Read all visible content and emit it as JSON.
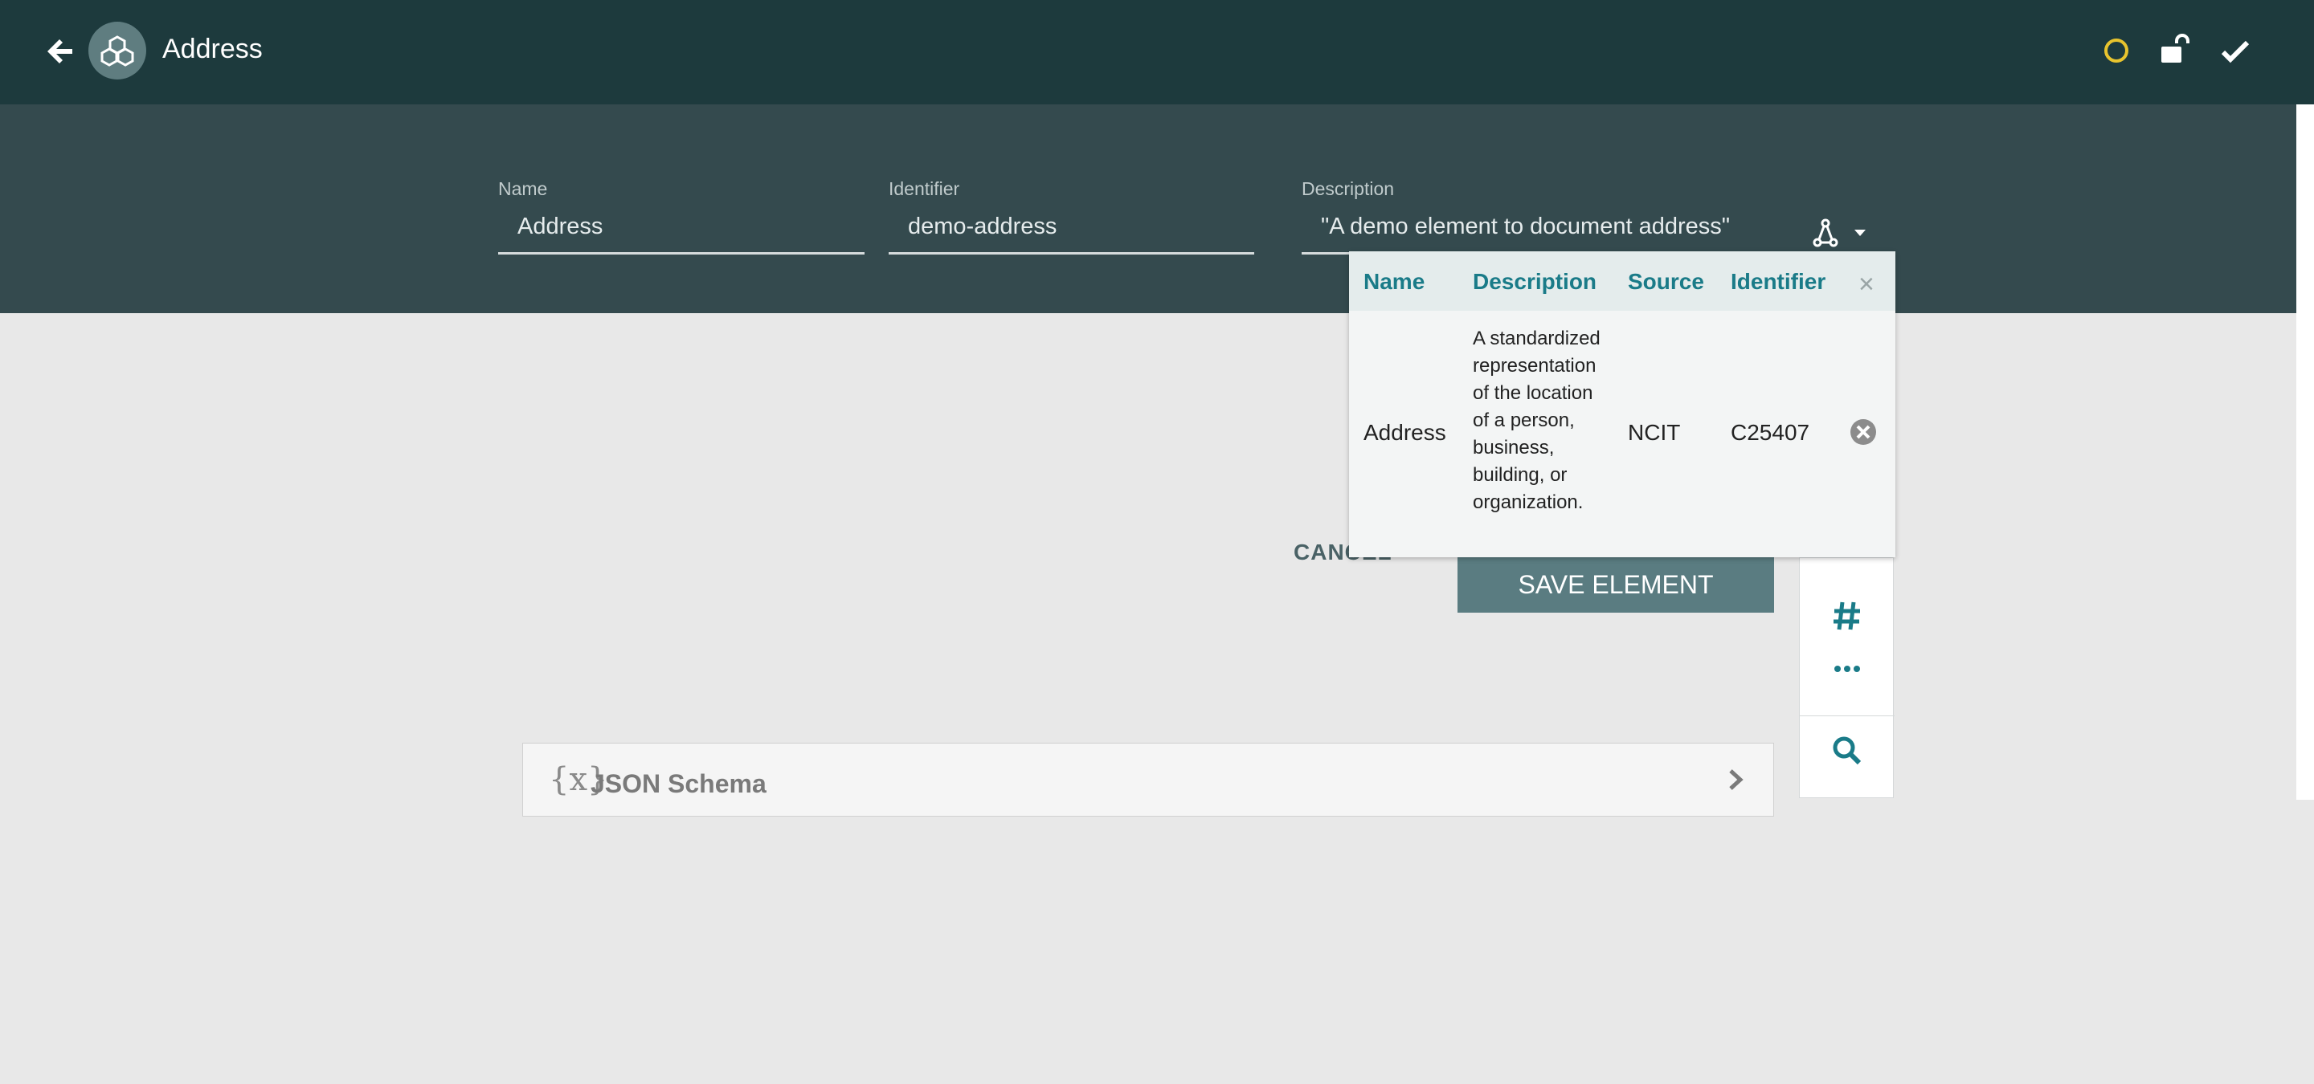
{
  "header": {
    "title": "Address",
    "back_icon": "arrow-left-icon",
    "logo_icon": "cubes-icon",
    "actions": [
      "status-circle-icon",
      "unlock-icon",
      "checkmark-icon"
    ],
    "colors": {
      "bar": "#1d3a3d",
      "status": "#e8c42e"
    }
  },
  "form": {
    "name": {
      "label": "Name",
      "value": "Address"
    },
    "identifier": {
      "label": "Identifier",
      "value": "demo-address"
    },
    "description": {
      "label": "Description",
      "value": "\"A demo element to document address\""
    }
  },
  "semantic_popover": {
    "columns": [
      "Name",
      "Description",
      "Source",
      "Identifier"
    ],
    "rows": [
      {
        "name": "Address",
        "description": "A standardized representation of the location of a person, business, building, or organization.",
        "source": "NCIT",
        "identifier": "C25407"
      }
    ],
    "close_glyph": "×"
  },
  "actions": {
    "cancel_label": "CANCEL",
    "save_label": "SAVE ELEMENT"
  },
  "side_toolbar": {
    "tools": [
      "hash-icon",
      "ellipsis-icon",
      "search-icon"
    ]
  },
  "accordion": {
    "icon_glyph": "{x}",
    "label": "JSON Schema"
  }
}
